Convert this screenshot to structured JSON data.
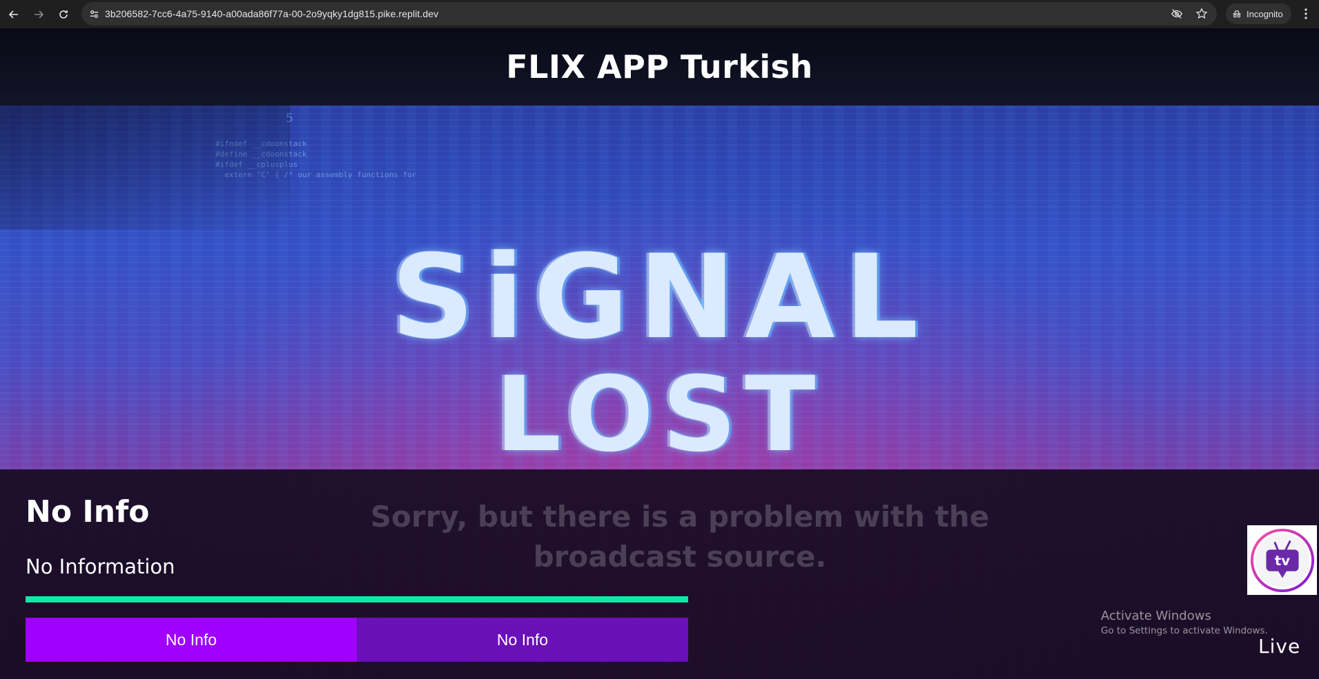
{
  "browser": {
    "url": "3b206582-7cc6-4a75-9140-a00ada86f77a-00-2o9yqky1dg815.pike.replit.dev",
    "incognito_label": "Incognito"
  },
  "header": {
    "title": "FLIX APP Turkish"
  },
  "hero": {
    "line1": "SiGNAL",
    "line2": "LOST",
    "code_number": "5",
    "code_text": "#ifndef __cdoonstack\n#define __cdoonstack\n#ifdef __cplusplus\n  extern \"C\" { /* our assembly functions for"
  },
  "player": {
    "title": "No Info",
    "subtitle": "No Information",
    "progress": 1.0,
    "buttons": [
      "No Info",
      "No Info"
    ],
    "error_message": "Sorry, but there is a problem with the broadcast source.",
    "live_label": "Live",
    "logo_text": "tv"
  },
  "os_watermark": {
    "line1": "Activate Windows",
    "line2": "Go to Settings to activate Windows."
  },
  "colors": {
    "progress": "#11e8a8",
    "button_primary": "#a000ff",
    "button_secondary": "#6a10b8",
    "logo_ring": "#c020c0"
  }
}
